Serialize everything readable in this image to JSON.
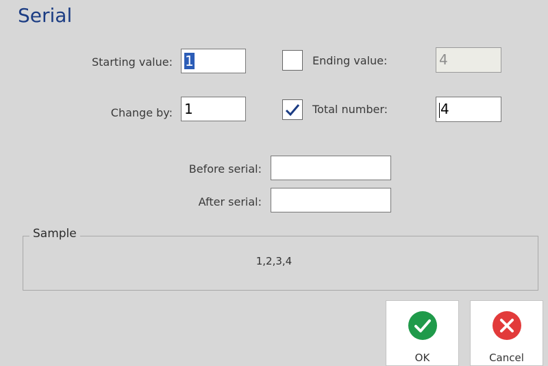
{
  "dialog": {
    "title": "Serial"
  },
  "fields": {
    "starting_value_label": "Starting value:",
    "starting_value": "1",
    "ending_value_label": "Ending value:",
    "ending_value": "4",
    "change_by_label": "Change by:",
    "change_by": "1",
    "total_number_label": "Total number:",
    "total_number": "4",
    "before_serial_label": "Before serial:",
    "before_serial": "",
    "after_serial_label": "After serial:",
    "after_serial": ""
  },
  "checkboxes": {
    "ending_value_checked": false,
    "total_number_checked": true
  },
  "sample": {
    "legend": "Sample",
    "text": "1,2,3,4"
  },
  "buttons": {
    "ok_label": "OK",
    "cancel_label": "Cancel"
  },
  "colors": {
    "title": "#1b3c83",
    "ok_icon": "#1f9a4a",
    "cancel_icon": "#e23a3a",
    "selection": "#2c5db7"
  },
  "icons": {
    "ok": "check-circle-icon",
    "cancel": "x-circle-icon"
  }
}
